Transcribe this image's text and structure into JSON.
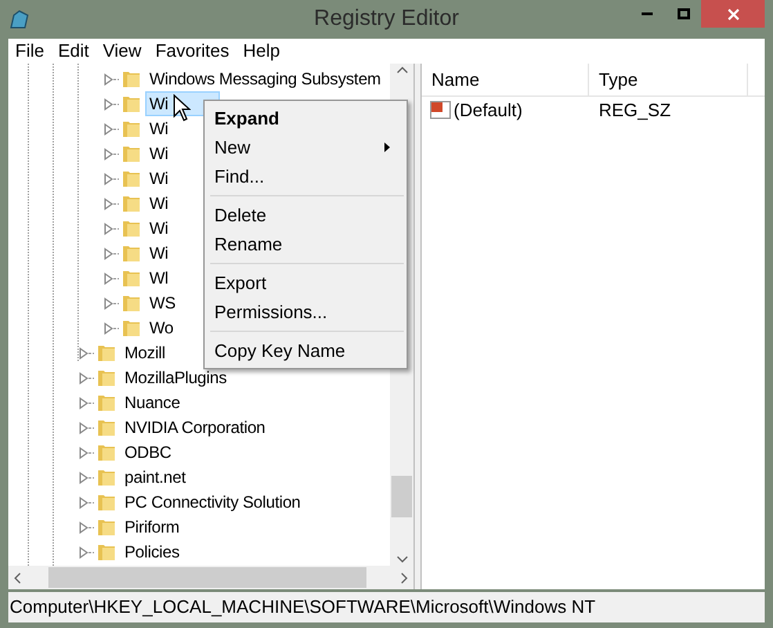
{
  "window": {
    "title": "Registry Editor"
  },
  "menu_bar": [
    "File",
    "Edit",
    "View",
    "Favorites",
    "Help"
  ],
  "tree": {
    "items": [
      {
        "children": [
          {
            "label": "Windows Messaging Subsystem",
            "selected": false
          },
          {
            "label": "Wi",
            "selected": true
          },
          {
            "label": "Wi",
            "selected": false
          },
          {
            "label": "Wi",
            "selected": false
          },
          {
            "label": "Wi",
            "selected": false
          },
          {
            "label": "Wi",
            "selected": false
          },
          {
            "label": "Wi",
            "selected": false
          },
          {
            "label": "Wi",
            "selected": false
          },
          {
            "label": "Wl",
            "selected": false
          },
          {
            "label": "WS",
            "selected": false
          },
          {
            "label": "Wo",
            "selected": false
          }
        ]
      },
      {
        "label": "Mozill",
        "selected": false
      },
      {
        "label": "MozillaPlugins",
        "selected": false
      },
      {
        "label": "Nuance",
        "selected": false
      },
      {
        "label": "NVIDIA Corporation",
        "selected": false
      },
      {
        "label": "ODBC",
        "selected": false
      },
      {
        "label": "paint.net",
        "selected": false
      },
      {
        "label": "PC Connectivity Solution",
        "selected": false
      },
      {
        "label": "Piriform",
        "selected": false
      },
      {
        "label": "Policies",
        "selected": false
      }
    ]
  },
  "values": {
    "columns": [
      "Name",
      "Type"
    ],
    "rows": [
      {
        "name": "(Default)",
        "type": "REG_SZ"
      }
    ]
  },
  "context_menu": [
    {
      "kind": "item",
      "label": "Expand",
      "default": true,
      "submenu": false
    },
    {
      "kind": "item",
      "label": "New",
      "default": false,
      "submenu": true
    },
    {
      "kind": "item",
      "label": "Find...",
      "default": false,
      "submenu": false
    },
    {
      "kind": "separator"
    },
    {
      "kind": "item",
      "label": "Delete",
      "default": false,
      "submenu": false
    },
    {
      "kind": "item",
      "label": "Rename",
      "default": false,
      "submenu": false
    },
    {
      "kind": "separator"
    },
    {
      "kind": "item",
      "label": "Export",
      "default": false,
      "submenu": false
    },
    {
      "kind": "item",
      "label": "Permissions...",
      "default": false,
      "submenu": false
    },
    {
      "kind": "separator"
    },
    {
      "kind": "item",
      "label": "Copy Key Name",
      "default": false,
      "submenu": false
    }
  ],
  "status_bar": "Computer\\HKEY_LOCAL_MACHINE\\SOFTWARE\\Microsoft\\Windows NT"
}
